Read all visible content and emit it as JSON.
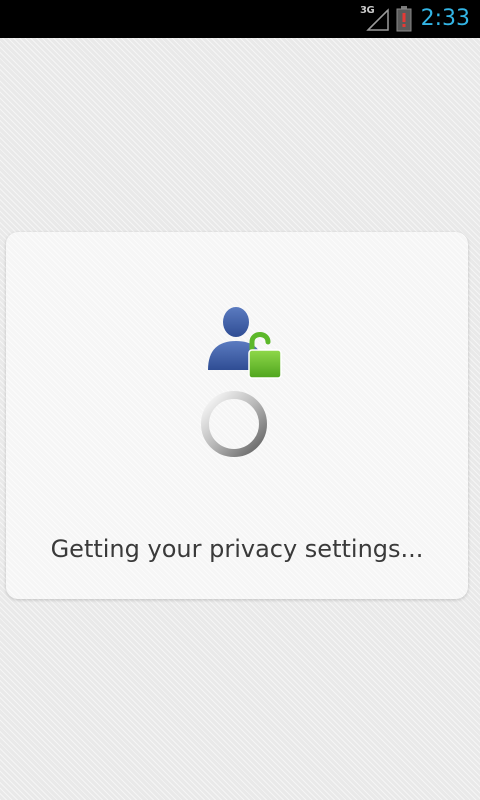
{
  "status_bar": {
    "network_type": "3G",
    "time": "2:33",
    "signal_icon": "signal-icon",
    "battery_icon": "battery-alert-icon",
    "clock_color": "#33b5e5"
  },
  "dialog": {
    "icon": "privacy-lock-icon",
    "spinner_icon": "loading-spinner-icon",
    "message": "Getting your privacy settings...",
    "accent_user_color": "#3b5998",
    "accent_lock_color": "#6cbf2a"
  }
}
